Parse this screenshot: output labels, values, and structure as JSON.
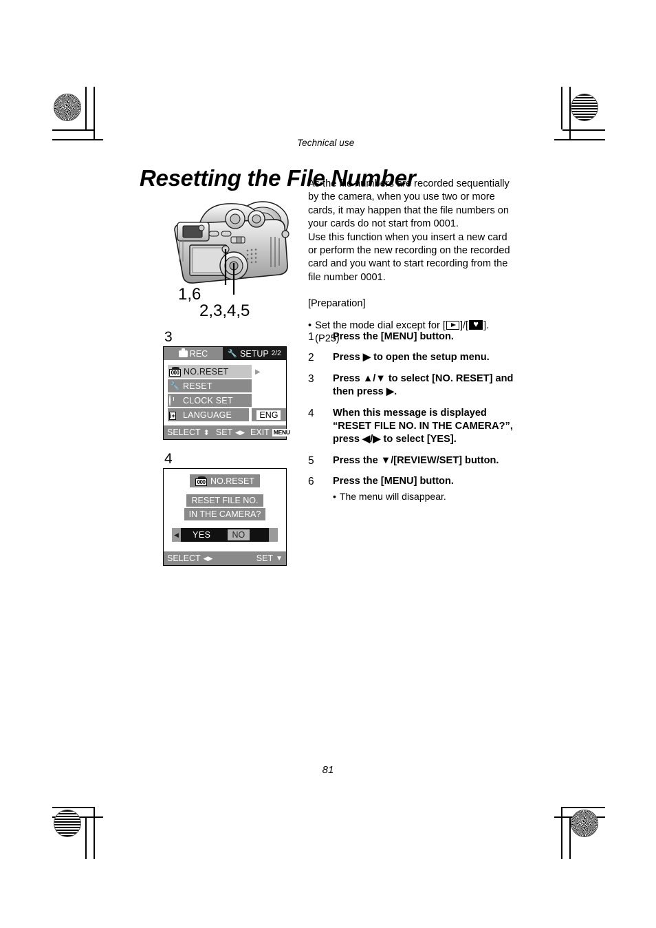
{
  "page": {
    "kicker": "Technical use",
    "title": "Resetting the File Number",
    "page_number": "81"
  },
  "body": {
    "para1": "As the file numbers are recorded sequentially by the camera, when you use two or more cards, it may happen that the file numbers on your cards do not start from 0001.",
    "para2": "Use this function when you insert a new card or perform the new recording on the recorded card and you want to start recording from the file number 0001.",
    "preparation_heading": "[Preparation]",
    "preparation_bullet": "•",
    "preparation_text_start": "Set the mode dial except for [",
    "preparation_text_mid": "]/[",
    "preparation_text_end": "]. (P25)",
    "icon_play": "play-icon",
    "icon_heart": "heart-icon"
  },
  "steps": [
    {
      "num": "1",
      "text": "Press the [MENU] button."
    },
    {
      "num": "2",
      "text": "Press ▶ to open the setup menu."
    },
    {
      "num": "3",
      "text": "Press ▲/▼ to select [NO. RESET] and then press ▶."
    },
    {
      "num": "4",
      "text": "When this message is displayed “RESET FILE NO. IN THE CAMERA?”, press ◀/▶ to select [YES]."
    },
    {
      "num": "5",
      "text": "Press the ▼/[REVIEW/SET] button."
    },
    {
      "num": "6",
      "text": "Press the [MENU] button.",
      "note_bullet": "•",
      "note": "The menu will disappear."
    }
  ],
  "camera": {
    "label_top": "1,6",
    "label_bottom": "2,3,4,5"
  },
  "screens": [
    {
      "marker": "3",
      "tabs": {
        "rec_label": "REC",
        "rec_icon": "camera-icon",
        "setup_label": "SETUP",
        "setup_icon": "wrench-screwdriver-icon",
        "page_indicator": "2/2"
      },
      "items": [
        {
          "icon": "film-counter-icon",
          "label": "NO.RESET",
          "selected": true,
          "arrow": "▶"
        },
        {
          "icon": "wrench-screwdriver-icon",
          "label": "RESET",
          "selected": false
        },
        {
          "icon": "clock-icon",
          "label": "CLOCK SET",
          "selected": false
        },
        {
          "icon": "language-icon",
          "label": "LANGUAGE",
          "selected": false,
          "value": "ENG"
        }
      ],
      "footer": {
        "select_label": "SELECT",
        "select_glyph": "⬍",
        "set_label": "SET",
        "set_glyph": "◀▶",
        "exit_label": "EXIT",
        "exit_chip": "MENU"
      }
    },
    {
      "marker": "4",
      "title_icon": "film-counter-icon",
      "title_label": "NO.RESET",
      "message_line1": "RESET FILE NO.",
      "message_line2": "IN THE CAMERA?",
      "left_arrow": "◀",
      "choice_yes": "YES",
      "choice_no": "NO",
      "footer": {
        "select_label": "SELECT",
        "select_glyph": "◀▶",
        "set_label": "SET",
        "set_glyph": "▼"
      }
    }
  ],
  "colors": {
    "lcd_grey": "#8a8a8a",
    "lcd_selected": "#c6c6c6",
    "lcd_black": "#1a1a1a",
    "paper": "#ffffff"
  }
}
